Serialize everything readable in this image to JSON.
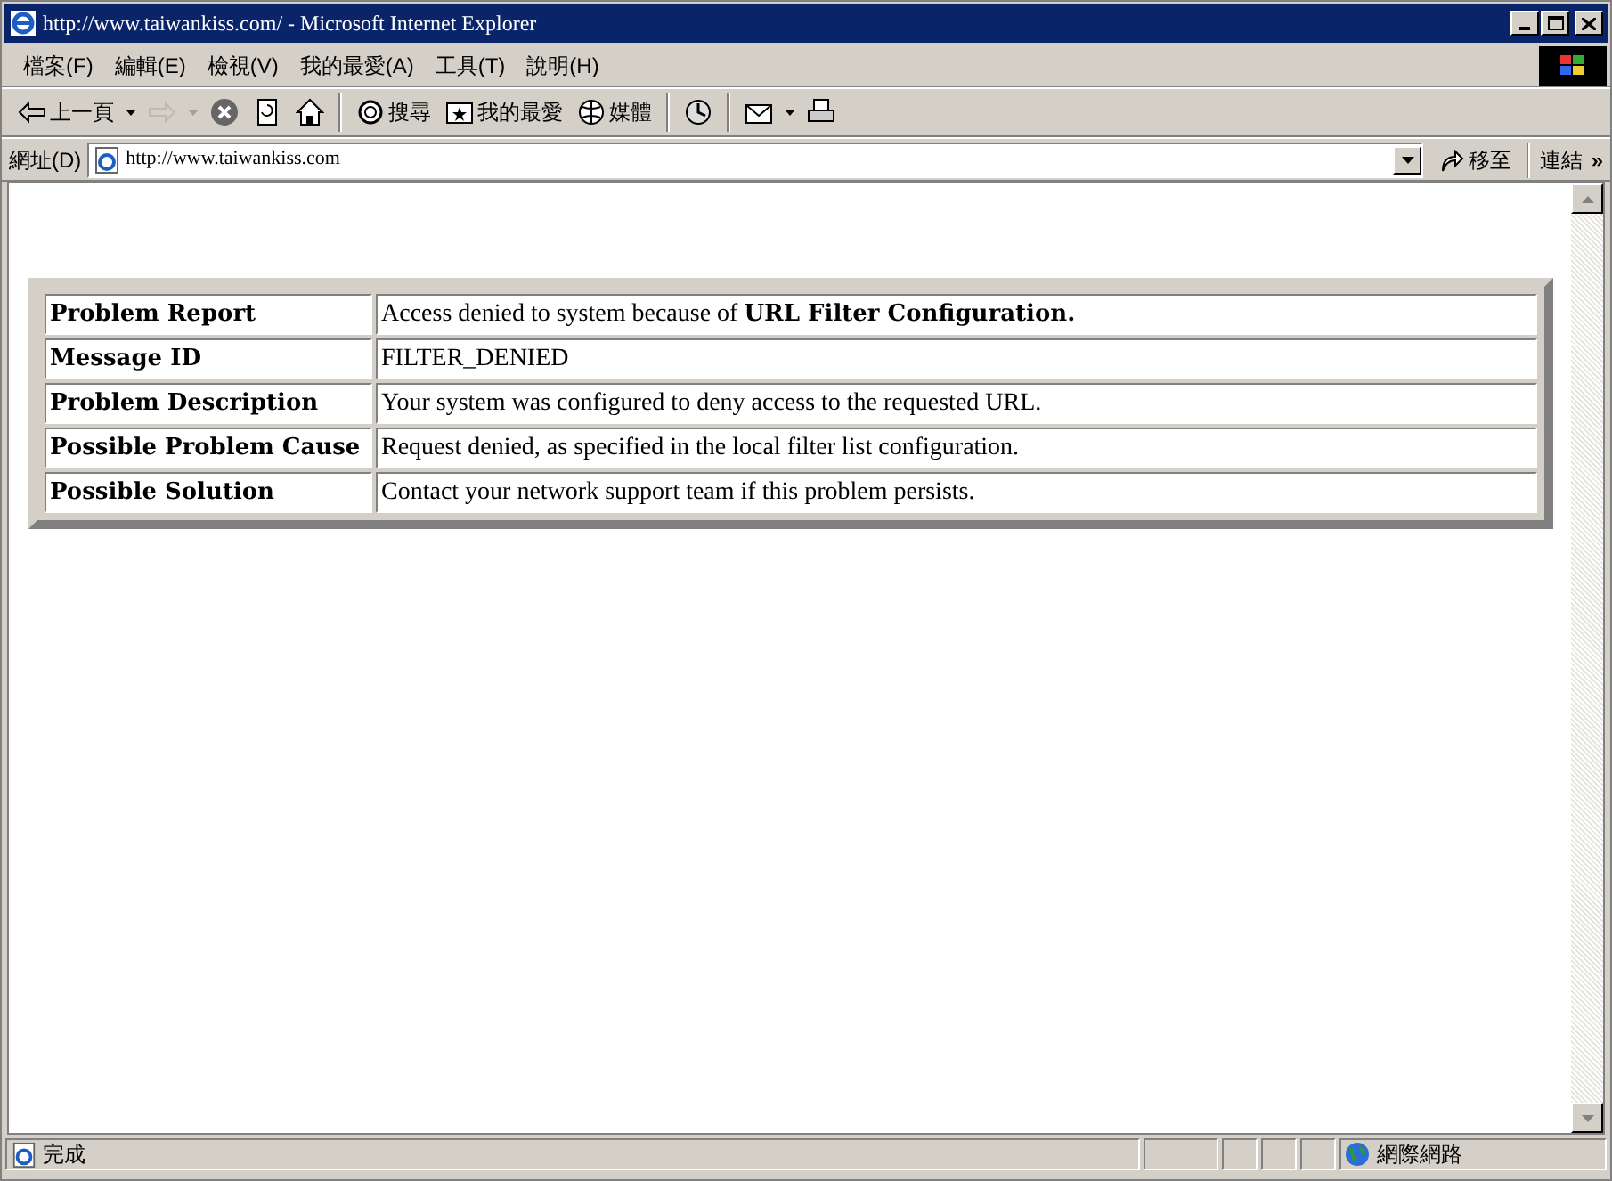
{
  "window": {
    "title": "http://www.taiwankiss.com/ - Microsoft Internet Explorer"
  },
  "menu_bar": [
    "檔案(F)",
    "編輯(E)",
    "檢視(V)",
    "我的最愛(A)",
    "工具(T)",
    "說明(H)"
  ],
  "toolbar": [
    {
      "kind": "back",
      "label": "上一頁",
      "disabled": false,
      "dropdown": true
    },
    {
      "kind": "forward",
      "disabled": true,
      "dropdown": true
    },
    {
      "kind": "stop",
      "disabled": false,
      "dropdown": false
    },
    {
      "kind": "refresh",
      "disabled": false,
      "dropdown": false
    },
    {
      "kind": "home",
      "disabled": false,
      "dropdown": false
    },
    {
      "kind": "search",
      "label": "搜尋",
      "disabled": false,
      "dropdown": false
    },
    {
      "kind": "favorites",
      "label": "我的最愛",
      "disabled": false,
      "dropdown": false
    },
    {
      "kind": "media",
      "label": "媒體",
      "disabled": false,
      "dropdown": false
    },
    {
      "kind": "history",
      "disabled": false,
      "dropdown": false
    },
    {
      "kind": "mail",
      "disabled": false,
      "dropdown": true
    },
    {
      "kind": "print",
      "disabled": false,
      "dropdown": false
    }
  ],
  "address_bar": {
    "label": "網址(D)",
    "url": "http://www.taiwankiss.com",
    "go": "移至",
    "links": "連結",
    "more": "»"
  },
  "table": {
    "rows": [
      {
        "label": "Problem Report",
        "value": "Access denied to system because of **URL Filter Configuration.**"
      },
      {
        "label": "Message ID",
        "value": "FILTER_DENIED"
      },
      {
        "label": "Problem Description",
        "value": "Your system was configured to deny access to the requested URL."
      },
      {
        "label": "Possible Problem Cause",
        "value": "Request denied, as specified in the local filter list configuration."
      },
      {
        "label": "Possible Solution",
        "value": "Contact your network support team if this problem persists."
      }
    ]
  },
  "status_bar": {
    "text": "完成",
    "zone": "網際網路"
  }
}
